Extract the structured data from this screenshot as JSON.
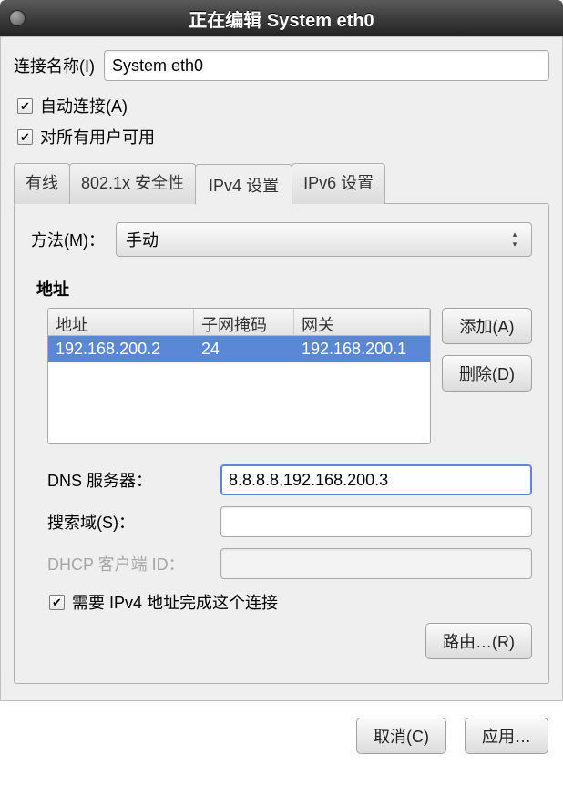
{
  "titlebar": {
    "title": "正在编辑 System eth0"
  },
  "name": {
    "label": "连接名称(I)",
    "value": "System eth0"
  },
  "checks": {
    "autoconnect": "自动连接(A)",
    "allusers": "对所有用户可用"
  },
  "tabs": [
    "有线",
    "802.1x 安全性",
    "IPv4 设置",
    "IPv6 设置"
  ],
  "ipv4": {
    "method_label": "方法(M)：",
    "method_value": "手动",
    "addresses_title": "地址",
    "table": {
      "headers": {
        "addr": "地址",
        "mask": "子网掩码",
        "gw": "网关"
      },
      "rows": [
        {
          "addr": "192.168.200.2",
          "mask": "24",
          "gw": "192.168.200.1"
        }
      ]
    },
    "buttons": {
      "add": "添加(A)",
      "del": "删除(D)"
    },
    "dns_label": "DNS 服务器：",
    "dns_value": "8.8.8.8,192.168.200.3",
    "search_label": "搜索域(S)：",
    "search_value": "",
    "dhcp_label": "DHCP 客户端 ID：",
    "dhcp_value": "",
    "require_ipv4": "需要 IPv4 地址完成这个连接",
    "routes": "路由…(R)"
  },
  "footer": {
    "cancel": "取消(C)",
    "apply": "应用…"
  }
}
